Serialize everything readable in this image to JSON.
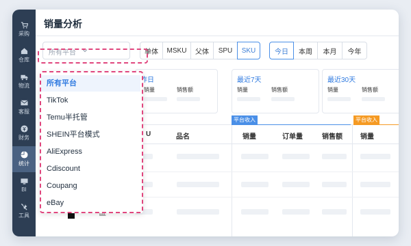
{
  "sidebar": {
    "items": [
      {
        "label": "采购",
        "icon": "cart-icon"
      },
      {
        "label": "仓库",
        "icon": "home-icon"
      },
      {
        "label": "物流",
        "icon": "truck-icon"
      },
      {
        "label": "客服",
        "icon": "mail-icon"
      },
      {
        "label": "财务",
        "icon": "money-icon"
      },
      {
        "label": "统计",
        "icon": "pie-chart-icon"
      },
      {
        "label": "BI",
        "icon": "monitor-icon"
      },
      {
        "label": "工具",
        "icon": "tools-icon"
      }
    ],
    "active": "统计"
  },
  "page": {
    "title": "销量分析"
  },
  "filters": {
    "platform_placeholder": "所有平台",
    "dimension_tabs": [
      "单体",
      "MSKU",
      "父体",
      "SPU",
      "SKU"
    ],
    "dimension_selected": "SKU",
    "period_tabs": [
      "今日",
      "本周",
      "本月",
      "今年"
    ],
    "period_selected": "今日"
  },
  "cards": [
    {
      "title": "昨日",
      "label1": "销量",
      "label2": "销售额"
    },
    {
      "title": "最近7天",
      "label1": "销量",
      "label2": "销售额"
    },
    {
      "title": "最近30天",
      "label1": "销量",
      "label2": "销售额"
    }
  ],
  "table": {
    "group_tags": [
      "平台收入",
      "平台收入"
    ],
    "headers": [
      "U",
      "品名",
      "销量",
      "订单量",
      "销售额",
      "销量"
    ]
  },
  "dropdown": {
    "options": [
      "所有平台",
      "TikTok",
      "Temu半托管",
      "SHEIN平台模式",
      "AliExpress",
      "Cdiscount",
      "Coupang",
      "eBay"
    ],
    "selected": "所有平台"
  },
  "colors": {
    "accent": "#2f7ae0",
    "sidebar": "#2d3e54",
    "highlight": "#e0457d",
    "tag_blue": "#4a8fe7",
    "tag_orange": "#f59a23"
  }
}
